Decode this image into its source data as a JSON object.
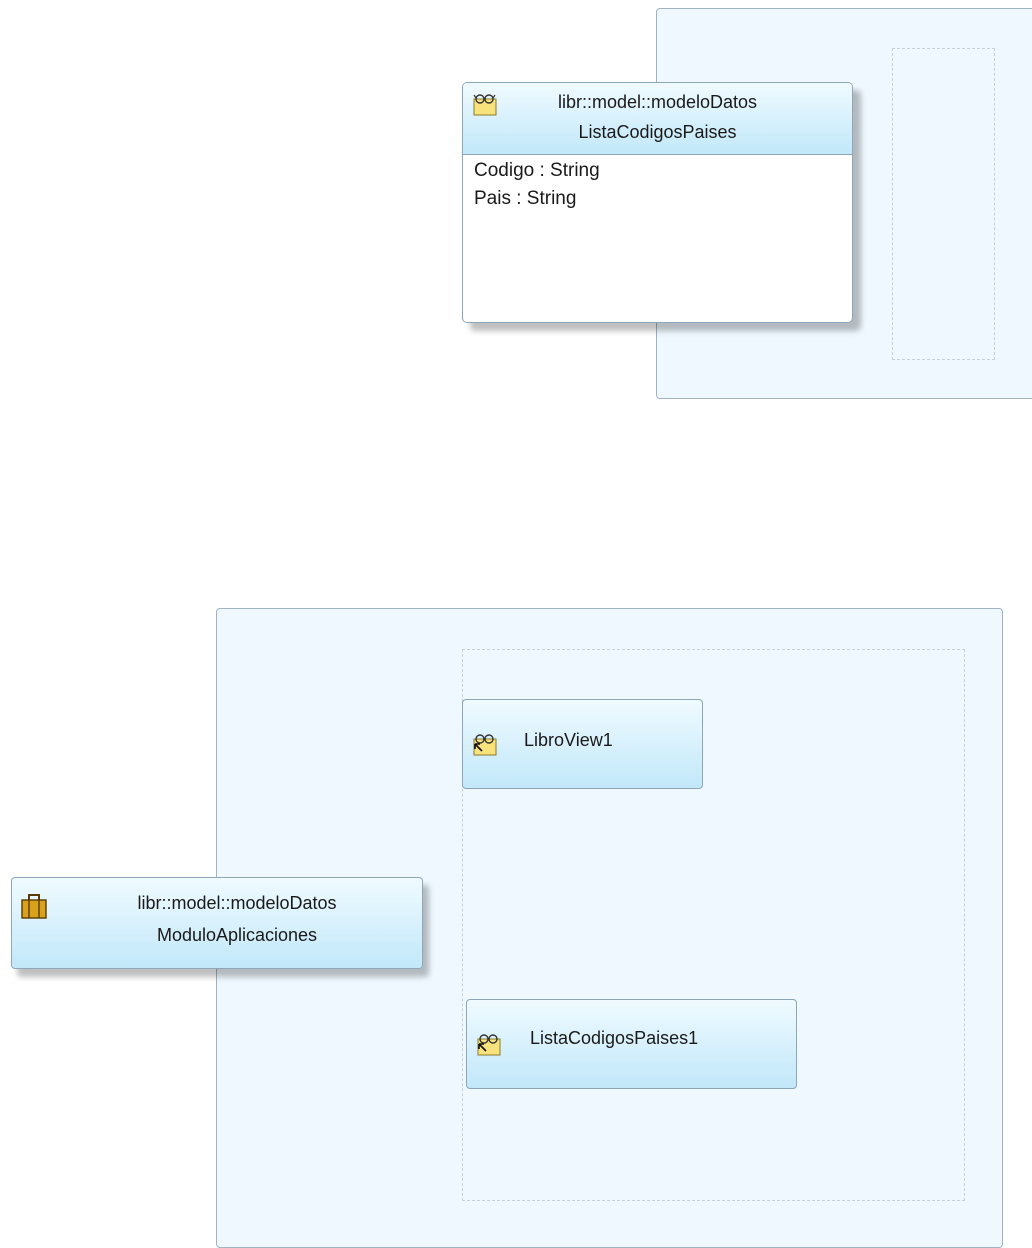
{
  "entity": {
    "package": "libr::model::modeloDatos",
    "name": "ListaCodigosPaises",
    "icon": "view-object-icon",
    "attributes": [
      "Codigo  : String",
      "Pais  : String"
    ]
  },
  "application_module": {
    "package": "libr::model::modeloDatos",
    "name": "ModuloAplicaciones",
    "icon": "briefcase-icon"
  },
  "view_instances": [
    {
      "name": "LibroView1",
      "icon": "view-instance-icon"
    },
    {
      "name": "ListaCodigosPaises1",
      "icon": "view-instance-icon"
    }
  ],
  "colors": {
    "panel_bg": "#eef8fe",
    "node_gradient_top": "#f0fbff",
    "node_gradient_bottom": "#c2e8f9",
    "border": "#8ea6ba",
    "icon_yellow": "#f8e27c"
  }
}
